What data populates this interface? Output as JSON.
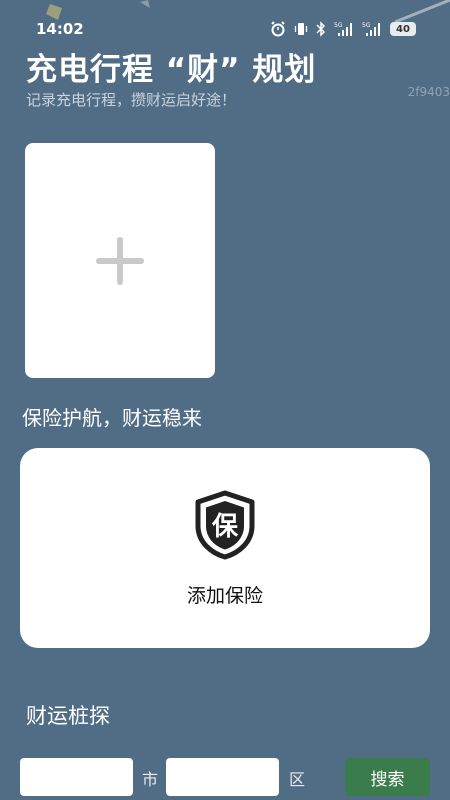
{
  "status_bar": {
    "time": "14:02",
    "battery_level": "40",
    "icons": [
      "alarm-icon",
      "vibrate-icon",
      "bluetooth-icon",
      "signal-5g-icon",
      "signal-5g-icon",
      "battery-icon"
    ]
  },
  "header": {
    "title": "充电行程 “财” 规划",
    "subtitle": "记录充电行程，攒财运启好途！",
    "watermark": "2f9403"
  },
  "upload": {
    "icon": "plus-icon"
  },
  "insurance": {
    "section_title": "保险护航，财运稳来",
    "icon_char": "保",
    "label": "添加保险"
  },
  "station_search": {
    "section_title": "财运桩探",
    "city_value": "",
    "city_unit": "市",
    "district_value": "",
    "district_unit": "区",
    "search_label": "搜索"
  },
  "colors": {
    "background": "#516d86",
    "search_button": "#3b7c4c",
    "card": "#ffffff"
  }
}
